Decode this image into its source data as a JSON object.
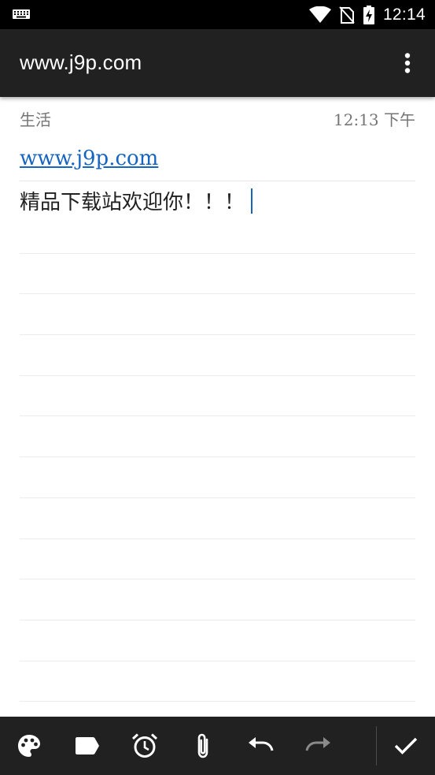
{
  "status_bar": {
    "time": "12:14"
  },
  "toolbar": {
    "title": "www.j9p.com",
    "more_icon": "more-vert-icon"
  },
  "note": {
    "category": "生活",
    "timestamp": "12:13 下午",
    "link_text": "www.j9p.com",
    "body_text": "精品下载站欢迎你！！！"
  },
  "bottom_bar": {
    "icons": [
      "palette-icon",
      "label-icon",
      "alarm-icon",
      "attach-icon",
      "undo-icon",
      "redo-icon",
      "check-icon"
    ]
  },
  "colors": {
    "toolbar": "#212121",
    "link": "#1565c0",
    "muted": "#757575",
    "disabled_icon": "#8a8a8a"
  }
}
